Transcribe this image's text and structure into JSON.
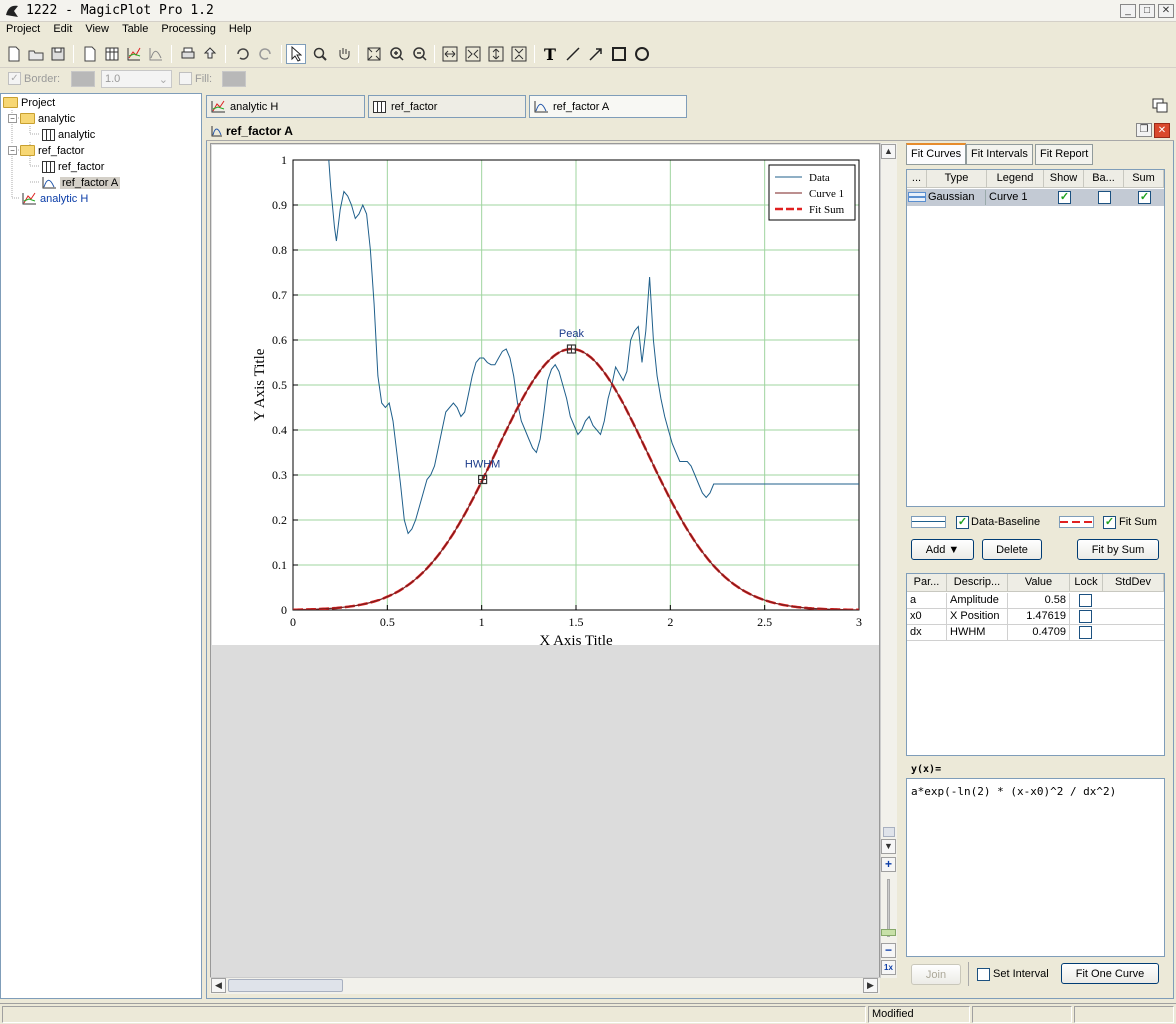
{
  "window": {
    "title": "1222 - MagicPlot Pro 1.2"
  },
  "menu": [
    "Project",
    "Edit",
    "View",
    "Table",
    "Processing",
    "Help"
  ],
  "propbar": {
    "border_label": "Border:",
    "border_width": "1.0",
    "fill_label": "Fill:"
  },
  "tree": {
    "root": "Project",
    "items": [
      {
        "label": "analytic",
        "kind": "folder"
      },
      {
        "label": "analytic",
        "kind": "table"
      },
      {
        "label": "ref_factor",
        "kind": "folder"
      },
      {
        "label": "ref_factor",
        "kind": "table"
      },
      {
        "label": "ref_factor A",
        "kind": "fit-plot"
      },
      {
        "label": "analytic H",
        "kind": "plot"
      }
    ]
  },
  "doc_tabs": [
    "analytic H",
    "ref_factor",
    "ref_factor A"
  ],
  "inner_window": {
    "title": "ref_factor A"
  },
  "fit_panel": {
    "tabs": [
      "Fit Curves",
      "Fit Intervals",
      "Fit Report"
    ],
    "curves_headers": [
      "...",
      "Type",
      "Legend",
      "Show",
      "Ba...",
      "Sum"
    ],
    "curves": [
      {
        "type": "Gaussian",
        "legend": "Curve 1",
        "show": true,
        "baseline": false,
        "sum": true
      }
    ],
    "data_baseline_label": "Data-Baseline",
    "fit_sum_label": "Fit Sum",
    "buttons": {
      "add": "Add ▼",
      "delete": "Delete",
      "fit_by_sum": "Fit by Sum",
      "join": "Join",
      "fit_one_curve": "Fit One Curve"
    },
    "set_interval_label": "Set Interval",
    "params_headers": [
      "Par...",
      "Descrip...",
      "Value",
      "Lock",
      "StdDev"
    ],
    "params": [
      {
        "name": "a",
        "description": "Amplitude",
        "value": "0.58"
      },
      {
        "name": "x0",
        "description": "X Position",
        "value": "1.47619"
      },
      {
        "name": "dx",
        "description": "HWHM",
        "value": "0.4709"
      }
    ],
    "formula_label": "y(x)=",
    "formula": "a*exp(-ln(2) * (x-x0)^2 / dx^2)"
  },
  "status": {
    "text": "Modified"
  },
  "colors": {
    "data": "#1f5f8b",
    "curve": "#7a1f1f",
    "fit_sum": "#e02020",
    "grid": "#9fd49f"
  },
  "chart_data": {
    "type": "line",
    "xlabel": "X Axis Title",
    "ylabel": "Y Axis Title",
    "xlim": [
      0,
      3
    ],
    "ylim": [
      0,
      1
    ],
    "xticks": [
      "0",
      "0.5",
      "1",
      "1.5",
      "2",
      "2.5",
      "3"
    ],
    "yticks": [
      "0",
      "0.1",
      "0.2",
      "0.3",
      "0.4",
      "0.5",
      "0.6",
      "0.7",
      "0.8",
      "0.9",
      "1"
    ],
    "grid": true,
    "legend_position": "top-right",
    "annotations": [
      {
        "text": "Peak",
        "x": 1.476,
        "y": 0.58
      },
      {
        "text": "HWHM",
        "x": 1.005,
        "y": 0.29
      }
    ],
    "series": [
      {
        "name": "Data",
        "style": "solid-thin",
        "x": [
          0.19,
          0.2,
          0.22,
          0.23,
          0.25,
          0.27,
          0.29,
          0.31,
          0.33,
          0.35,
          0.37,
          0.39,
          0.41,
          0.43,
          0.45,
          0.47,
          0.49,
          0.51,
          0.53,
          0.55,
          0.57,
          0.59,
          0.61,
          0.63,
          0.65,
          0.67,
          0.69,
          0.71,
          0.73,
          0.75,
          0.77,
          0.79,
          0.81,
          0.83,
          0.85,
          0.87,
          0.89,
          0.91,
          0.93,
          0.95,
          0.97,
          0.99,
          1.01,
          1.03,
          1.05,
          1.07,
          1.09,
          1.11,
          1.13,
          1.15,
          1.17,
          1.19,
          1.21,
          1.23,
          1.25,
          1.27,
          1.29,
          1.31,
          1.33,
          1.35,
          1.37,
          1.39,
          1.41,
          1.43,
          1.45,
          1.47,
          1.49,
          1.51,
          1.53,
          1.55,
          1.57,
          1.59,
          1.61,
          1.63,
          1.65,
          1.67,
          1.69,
          1.71,
          1.73,
          1.75,
          1.77,
          1.79,
          1.81,
          1.83,
          1.85,
          1.87,
          1.89,
          1.91,
          1.93,
          1.95,
          1.97,
          1.99,
          2.01,
          2.03,
          2.05,
          2.07,
          2.09,
          2.11,
          2.13,
          2.15,
          2.17,
          2.19,
          2.21,
          2.23,
          2.25,
          2.27,
          2.29,
          2.31,
          2.33,
          2.35,
          2.37,
          2.39,
          2.41,
          2.43,
          2.45,
          2.47,
          2.49,
          2.51,
          2.53,
          2.55,
          2.57,
          2.59,
          2.61,
          2.63,
          2.65,
          2.67,
          2.69,
          2.71,
          2.73,
          2.75,
          2.77,
          2.79,
          2.81,
          2.83,
          2.85,
          2.87,
          2.89,
          2.91,
          2.93,
          2.95,
          2.97,
          2.99,
          3.0
        ],
        "y": [
          1.0,
          0.94,
          0.85,
          0.82,
          0.89,
          0.93,
          0.92,
          0.9,
          0.87,
          0.88,
          0.9,
          0.88,
          0.8,
          0.68,
          0.52,
          0.46,
          0.45,
          0.46,
          0.42,
          0.35,
          0.28,
          0.2,
          0.17,
          0.18,
          0.2,
          0.23,
          0.26,
          0.29,
          0.3,
          0.32,
          0.36,
          0.4,
          0.44,
          0.45,
          0.46,
          0.45,
          0.43,
          0.44,
          0.48,
          0.52,
          0.55,
          0.56,
          0.56,
          0.55,
          0.545,
          0.545,
          0.56,
          0.575,
          0.58,
          0.56,
          0.52,
          0.46,
          0.42,
          0.4,
          0.38,
          0.36,
          0.35,
          0.38,
          0.44,
          0.51,
          0.535,
          0.545,
          0.53,
          0.5,
          0.47,
          0.43,
          0.41,
          0.39,
          0.4,
          0.42,
          0.43,
          0.41,
          0.4,
          0.39,
          0.42,
          0.47,
          0.5,
          0.54,
          0.525,
          0.51,
          0.53,
          0.6,
          0.62,
          0.63,
          0.55,
          0.62,
          0.74,
          0.6,
          0.52,
          0.47,
          0.43,
          0.4,
          0.37,
          0.35,
          0.33,
          0.33,
          0.33,
          0.32,
          0.3,
          0.28,
          0.26,
          0.25,
          0.26,
          0.28,
          0.28,
          0.28,
          0.28,
          0.28,
          0.28,
          0.28,
          0.28,
          0.28,
          0.28,
          0.28,
          0.28,
          0.28,
          0.28,
          0.28,
          0.28,
          0.28,
          0.28,
          0.28,
          0.28,
          0.28,
          0.28,
          0.28,
          0.28,
          0.28,
          0.28,
          0.28,
          0.28,
          0.28,
          0.28,
          0.28,
          0.28,
          0.28,
          0.28,
          0.28,
          0.28,
          0.28,
          0.28,
          0.28,
          0.28
        ]
      },
      {
        "name": "Curve 1",
        "style": "solid-thin",
        "gaussian": {
          "a": 0.58,
          "x0": 1.47619,
          "dx": 0.4709
        }
      },
      {
        "name": "Fit Sum",
        "style": "dashed-thick",
        "gaussian": {
          "a": 0.58,
          "x0": 1.47619,
          "dx": 0.4709
        }
      }
    ]
  }
}
